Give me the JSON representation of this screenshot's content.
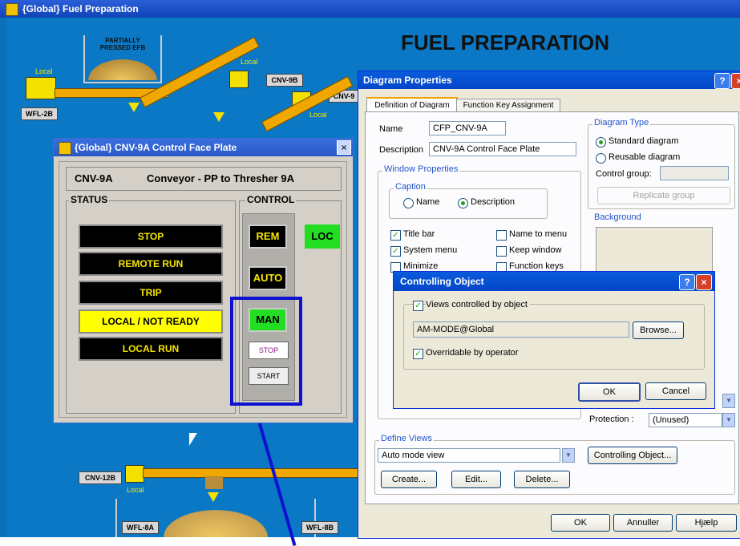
{
  "main_window": {
    "title": "{Global} Fuel Preparation",
    "heading": "FUEL PREPARATION",
    "equipment": {
      "hopper_label": "PARTIALLY\nPRESSED EFB",
      "local_1": "Local",
      "local_2": "Local",
      "local_3": "Local",
      "local_4": "Local",
      "wfl_2b": "WFL-2B",
      "cnv_9b": "CNV-9B",
      "cnv_9x": "CNV-9",
      "cnv_12b": "CNV-12B",
      "wfl_8a": "WFL-8A",
      "wfl_8b": "WFL-8B"
    }
  },
  "faceplate": {
    "title": "{Global} CNV-9A Control Face Plate",
    "tag": "CNV-9A",
    "description": "Conveyor - PP to Thresher 9A",
    "status_label": "STATUS",
    "control_label": "CONTROL",
    "status_items": [
      "STOP",
      "REMOTE RUN",
      "TRIP",
      "LOCAL / NOT READY",
      "LOCAL RUN"
    ],
    "active_status_index": 3,
    "rem": "REM",
    "loc": "LOC",
    "auto": "AUTO",
    "man": "MAN",
    "stop": "STOP",
    "start": "START"
  },
  "diagram_properties": {
    "title": "Diagram Properties",
    "tabs": [
      "Definition of Diagram",
      "Function Key Assignment"
    ],
    "name_label": "Name",
    "name_value": "CFP_CNV-9A",
    "description_label": "Description",
    "description_value": "CNV-9A Control Face Plate",
    "diagram_type_label": "Diagram Type",
    "standard_diagram": "Standard diagram",
    "reusable_diagram": "Reusable diagram",
    "control_group_label": "Control group:",
    "replicate_group": "Replicate group",
    "window_properties_label": "Window Properties",
    "caption_label": "Caption",
    "caption_name": "Name",
    "caption_description": "Description",
    "background_label": "Background",
    "title_bar": "Title bar",
    "system_menu": "System menu",
    "minimize": "Minimize",
    "name_to_menu": "Name to menu",
    "keep_window": "Keep window",
    "function_keys": "Function keys",
    "protection_label": "Protection :",
    "protection_value": "(Unused)",
    "define_views_label": "Define Views",
    "view_value": "Auto mode view",
    "controlling_object_button": "Controlling Object...",
    "create_button": "Create...",
    "edit_button": "Edit...",
    "delete_button": "Delete...",
    "ok_button": "OK",
    "cancel_button": "Annuller",
    "help_button": "Hjælp"
  },
  "controlling_object": {
    "title": "Controlling Object",
    "views_controlled": "Views controlled by object",
    "object_value": "AM-MODE@Global",
    "browse_button": "Browse...",
    "overridable": "Overridable by operator",
    "ok_button": "OK",
    "cancel_button": "Cancel"
  },
  "colors": {
    "process_background": "#0a78c4",
    "highlight_box": "#1010d0",
    "indicator_yellow": "#ffff00",
    "indicator_green": "#22dd22",
    "xp_title_blue": "#0a5bdc"
  },
  "icons": [
    "app-icon",
    "close-icon",
    "help-icon",
    "cursor-icon",
    "dropdown-arrow-icon",
    "check-icon"
  ]
}
